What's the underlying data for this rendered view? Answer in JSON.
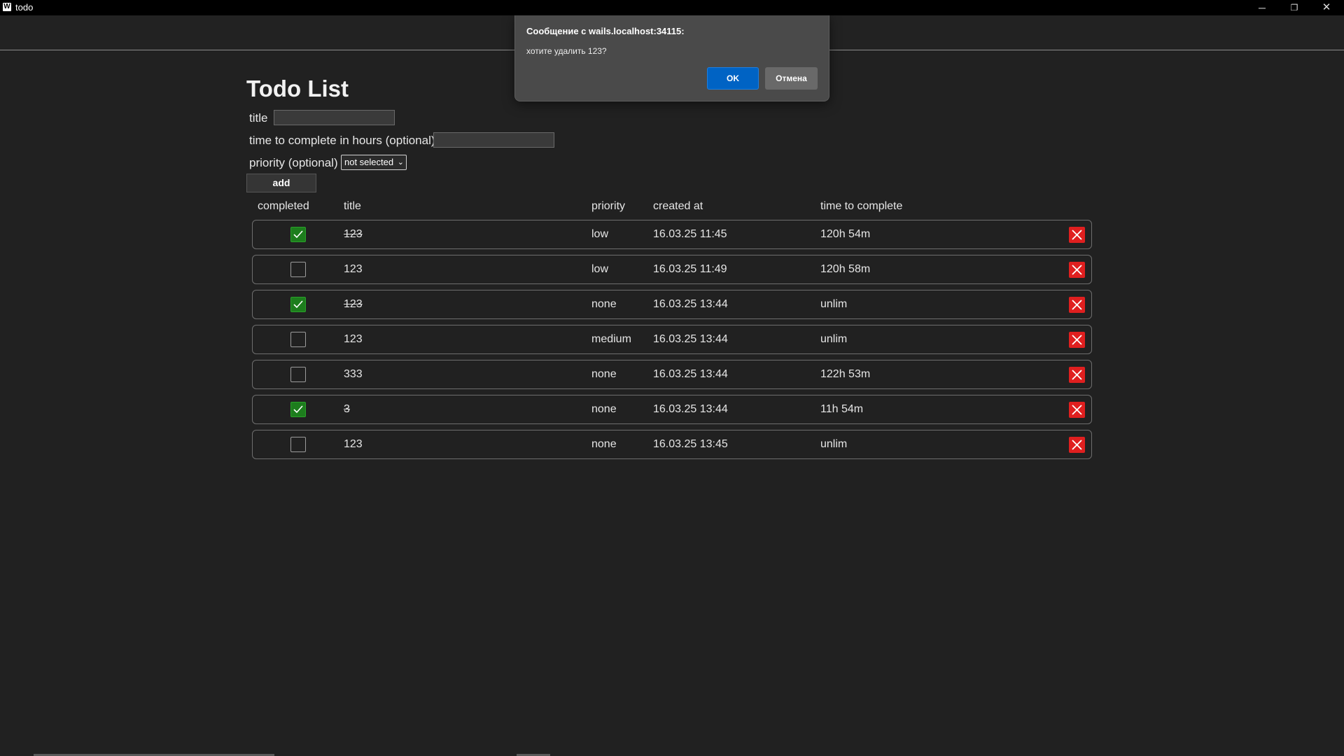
{
  "window": {
    "app_icon": "W",
    "title": "todo",
    "minimize_glyph": "─",
    "restore_glyph": "❐",
    "close_glyph": "✕"
  },
  "page": {
    "heading": "Todo List",
    "form": {
      "title_label": "title",
      "title_value": "",
      "time_label": "time to complete in hours (optional)",
      "time_value": "",
      "priority_label": "priority (optional)",
      "priority_selected": "not selected",
      "add_label": "add"
    },
    "columns": {
      "completed": "completed",
      "title": "title",
      "priority": "priority",
      "created_at": "created at",
      "time_to_complete": "time to complete"
    },
    "todos": [
      {
        "completed": true,
        "title": "123",
        "priority": "low",
        "created_at": "16.03.25 11:45",
        "time_to_complete": "120h 54m"
      },
      {
        "completed": false,
        "title": "123",
        "priority": "low",
        "created_at": "16.03.25 11:49",
        "time_to_complete": "120h 58m"
      },
      {
        "completed": true,
        "title": "123",
        "priority": "none",
        "created_at": "16.03.25 13:44",
        "time_to_complete": "unlim"
      },
      {
        "completed": false,
        "title": "123",
        "priority": "medium",
        "created_at": "16.03.25 13:44",
        "time_to_complete": "unlim"
      },
      {
        "completed": false,
        "title": "333",
        "priority": "none",
        "created_at": "16.03.25 13:44",
        "time_to_complete": "122h 53m"
      },
      {
        "completed": true,
        "title": "3",
        "priority": "none",
        "created_at": "16.03.25 13:44",
        "time_to_complete": "11h 54m"
      },
      {
        "completed": false,
        "title": "123",
        "priority": "none",
        "created_at": "16.03.25 13:45",
        "time_to_complete": "unlim"
      }
    ]
  },
  "dialog": {
    "title": "Сообщение с wails.localhost:34115:",
    "message": "хотите удалить 123?",
    "ok_label": "OK",
    "cancel_label": "Отмена"
  },
  "colors": {
    "background": "#212121",
    "checkbox_checked": "#1d7d1d",
    "delete_button": "#e01f1f",
    "dialog_ok": "#0063c4",
    "dialog_bg": "#4a4a4a"
  }
}
